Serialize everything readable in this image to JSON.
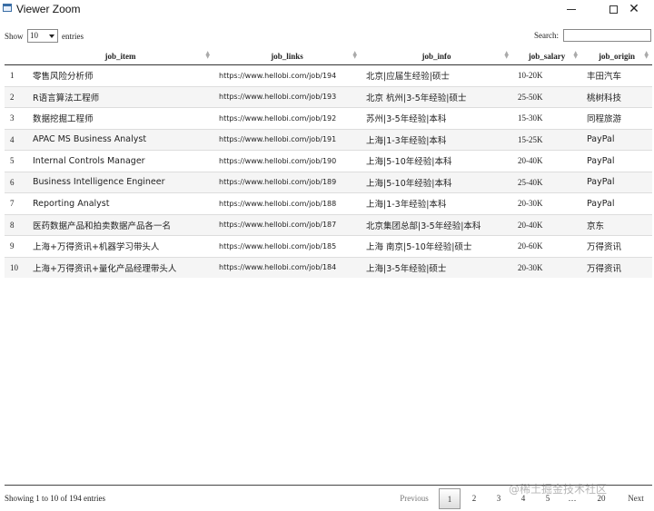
{
  "window": {
    "title": "Viewer Zoom"
  },
  "controls": {
    "show_label": "Show",
    "entries_value": "10",
    "entries_label": "entries",
    "search_label": "Search:",
    "search_value": ""
  },
  "table": {
    "headers": [
      "job_item",
      "job_links",
      "job_info",
      "job_salary",
      "job_origin"
    ],
    "rows": [
      [
        "1",
        "零售风险分析师",
        "https://www.hellobi.com/job/194",
        "北京|应届生经验|硕士",
        "10-20K",
        "丰田汽车"
      ],
      [
        "2",
        "R语言算法工程师",
        "https://www.hellobi.com/job/193",
        "北京 杭州|3-5年经验|硕士",
        "25-50K",
        "桃树科技"
      ],
      [
        "3",
        "数据挖掘工程师",
        "https://www.hellobi.com/job/192",
        "苏州|3-5年经验|本科",
        "15-30K",
        "同程旅游"
      ],
      [
        "4",
        "APAC MS Business Analyst",
        "https://www.hellobi.com/job/191",
        "上海|1-3年经验|本科",
        "15-25K",
        "PayPal"
      ],
      [
        "5",
        "Internal Controls Manager",
        "https://www.hellobi.com/job/190",
        "上海|5-10年经验|本科",
        "20-40K",
        "PayPal"
      ],
      [
        "6",
        "Business Intelligence Engineer",
        "https://www.hellobi.com/job/189",
        "上海|5-10年经验|本科",
        "25-40K",
        "PayPal"
      ],
      [
        "7",
        "Reporting Analyst",
        "https://www.hellobi.com/job/188",
        "上海|1-3年经验|本科",
        "20-30K",
        "PayPal"
      ],
      [
        "8",
        "医药数据产品和拍卖数据产品各一名",
        "https://www.hellobi.com/job/187",
        "北京集团总部|3-5年经验|本科",
        "20-40K",
        "京东"
      ],
      [
        "9",
        "上海+万得资讯+机器学习带头人",
        "https://www.hellobi.com/job/185",
        "上海 南京|5-10年经验|硕士",
        "20-60K",
        "万得资讯"
      ],
      [
        "10",
        "上海+万得资讯+量化产品经理带头人",
        "https://www.hellobi.com/job/184",
        "上海|3-5年经验|硕士",
        "20-30K",
        "万得资讯"
      ]
    ]
  },
  "footer": {
    "info": "Showing 1 to 10 of 194 entries"
  },
  "pagination": {
    "previous": "Previous",
    "pages": [
      "1",
      "2",
      "3",
      "4",
      "5"
    ],
    "ellipsis": "…",
    "last": "20",
    "next": "Next"
  },
  "watermark": "@稀土掘金技术社区"
}
